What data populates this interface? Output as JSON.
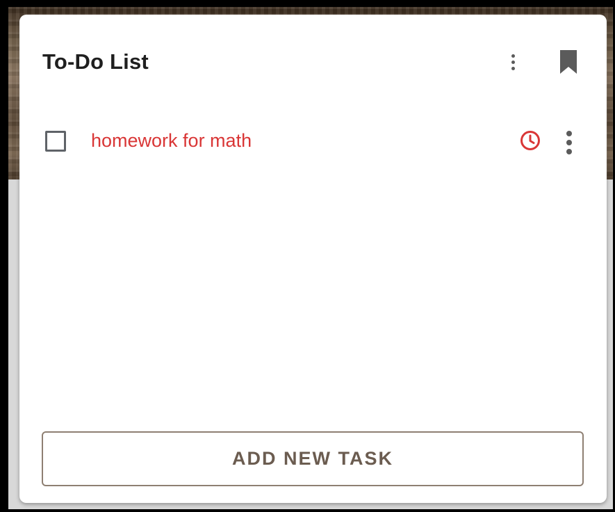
{
  "widget": {
    "title": "To-Do List",
    "header_icons": [
      "more-vert-icon",
      "bookmark-icon"
    ]
  },
  "tasks": [
    {
      "text": "homework for math",
      "checked": false,
      "overdue": true,
      "icons": [
        "clock-icon",
        "more-vert-icon"
      ]
    }
  ],
  "add_button": {
    "label": "ADD NEW TASK"
  },
  "colors": {
    "overdue_text": "#d93636",
    "title_text": "#1f1f1f",
    "icon_gray": "#5b5b5b",
    "button_text": "#6b5c50",
    "button_border": "#8e7f72"
  }
}
